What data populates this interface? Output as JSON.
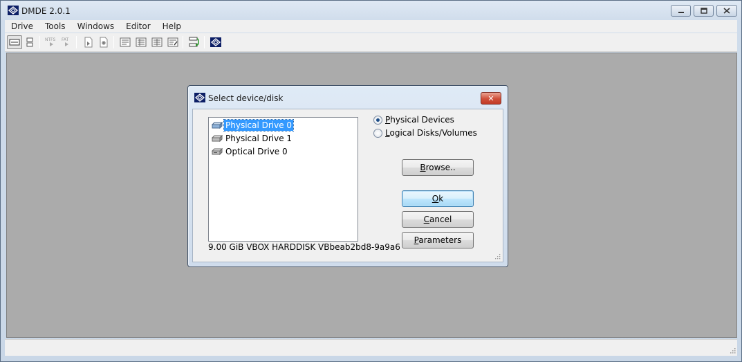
{
  "window": {
    "title": "DMDE 2.0.1",
    "caption_buttons": {
      "minimize": "—",
      "maximize": "□",
      "close": "✕"
    }
  },
  "menu": [
    "Drive",
    "Tools",
    "Windows",
    "Editor",
    "Help"
  ],
  "toolbar": {
    "icons": [
      "drive-mode-icon",
      "partition-mode-icon",
      "ntfs-icon",
      "fat-icon",
      "open-file-icon",
      "new-file-icon",
      "list-view-icon",
      "details-view-icon",
      "table-view-icon",
      "edit-view-icon",
      "go-icon",
      "dmde-logo-icon"
    ],
    "ntfs_label": "NTFS",
    "fat_label": "FAT"
  },
  "dialog": {
    "title": "Select device/disk",
    "close_label": "✕",
    "devices": [
      {
        "label": "Physical Drive 0",
        "selected": true
      },
      {
        "label": "Physical Drive 1",
        "selected": false
      },
      {
        "label": "Optical Drive 0",
        "selected": false
      }
    ],
    "disk_info": "9.00 GiB VBOX HARDDISK VBbeab2bd8-9a9a6",
    "radio": {
      "physical": {
        "label_pre": "",
        "label_u": "P",
        "label_post": "hysical Devices",
        "checked": true
      },
      "logical": {
        "label_pre": "",
        "label_u": "L",
        "label_post": "ogical Disks/Volumes",
        "checked": false
      }
    },
    "buttons": {
      "browse": {
        "pre": "",
        "u": "B",
        "post": "rowse.."
      },
      "ok": {
        "pre": "",
        "u": "O",
        "post": "k"
      },
      "cancel": {
        "pre": "",
        "u": "C",
        "post": "ancel"
      },
      "parameters": {
        "pre": "",
        "u": "P",
        "post": "arameters"
      }
    }
  },
  "colors": {
    "workspace": "#ababab",
    "selection": "#3399ff",
    "close_red": "#c94431"
  }
}
